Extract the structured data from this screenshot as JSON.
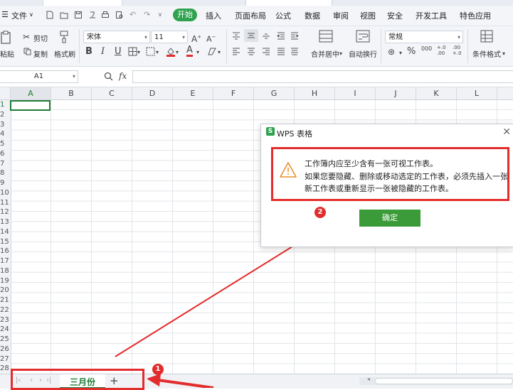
{
  "menu": {
    "file_label": "文件",
    "start_label": "开始",
    "items": [
      "插入",
      "页面布局",
      "公式",
      "数据",
      "审阅",
      "视图",
      "安全",
      "开发工具",
      "特色应用"
    ]
  },
  "ribbon": {
    "cut_label": "剪切",
    "copy_label": "复制",
    "paste_label": "粘贴",
    "format_painter_label": "格式刷",
    "font_name": "宋体",
    "font_size": "11",
    "merge_center_label": "合并居中",
    "wrap_text_label": "自动换行",
    "number_format": "常规",
    "conditional_format_label": "条件格式",
    "bold": "B",
    "italic": "I",
    "underline": "U",
    "percent": "%",
    "thousands": "000",
    "inc_decimal": "+.0\n.00",
    "dec_decimal": ".00\n+.0"
  },
  "formula_bar": {
    "cell_ref": "A1",
    "fx_label": "fx",
    "value": ""
  },
  "grid": {
    "columns": [
      "A",
      "B",
      "C",
      "D",
      "E",
      "F",
      "G",
      "H",
      "I",
      "J",
      "K",
      "L",
      "M"
    ],
    "rows": [
      "1",
      "2",
      "3",
      "4",
      "5",
      "6",
      "7",
      "8",
      "9",
      "10",
      "11",
      "12",
      "13",
      "14",
      "15",
      "16",
      "17",
      "18",
      "19",
      "20",
      "21",
      "22",
      "23",
      "24",
      "25",
      "26",
      "27",
      "28"
    ]
  },
  "sheet_tabs": {
    "active": "三月份",
    "add_label": "+"
  },
  "dialog": {
    "title": "WPS 表格",
    "logo_letter": "S",
    "message_line1": "工作簿内应至少含有一张可视工作表。",
    "message_line2": "如果您要隐藏、删除或移动选定的工作表，必须先插入一张",
    "message_line3": "新工作表或重新显示一张被隐藏的工作表。",
    "ok_label": "确定"
  },
  "annotations": {
    "badge1": "1",
    "badge2": "2"
  },
  "colors": {
    "accent_green": "#2fa24f",
    "annotation_red": "#e32c2c"
  }
}
